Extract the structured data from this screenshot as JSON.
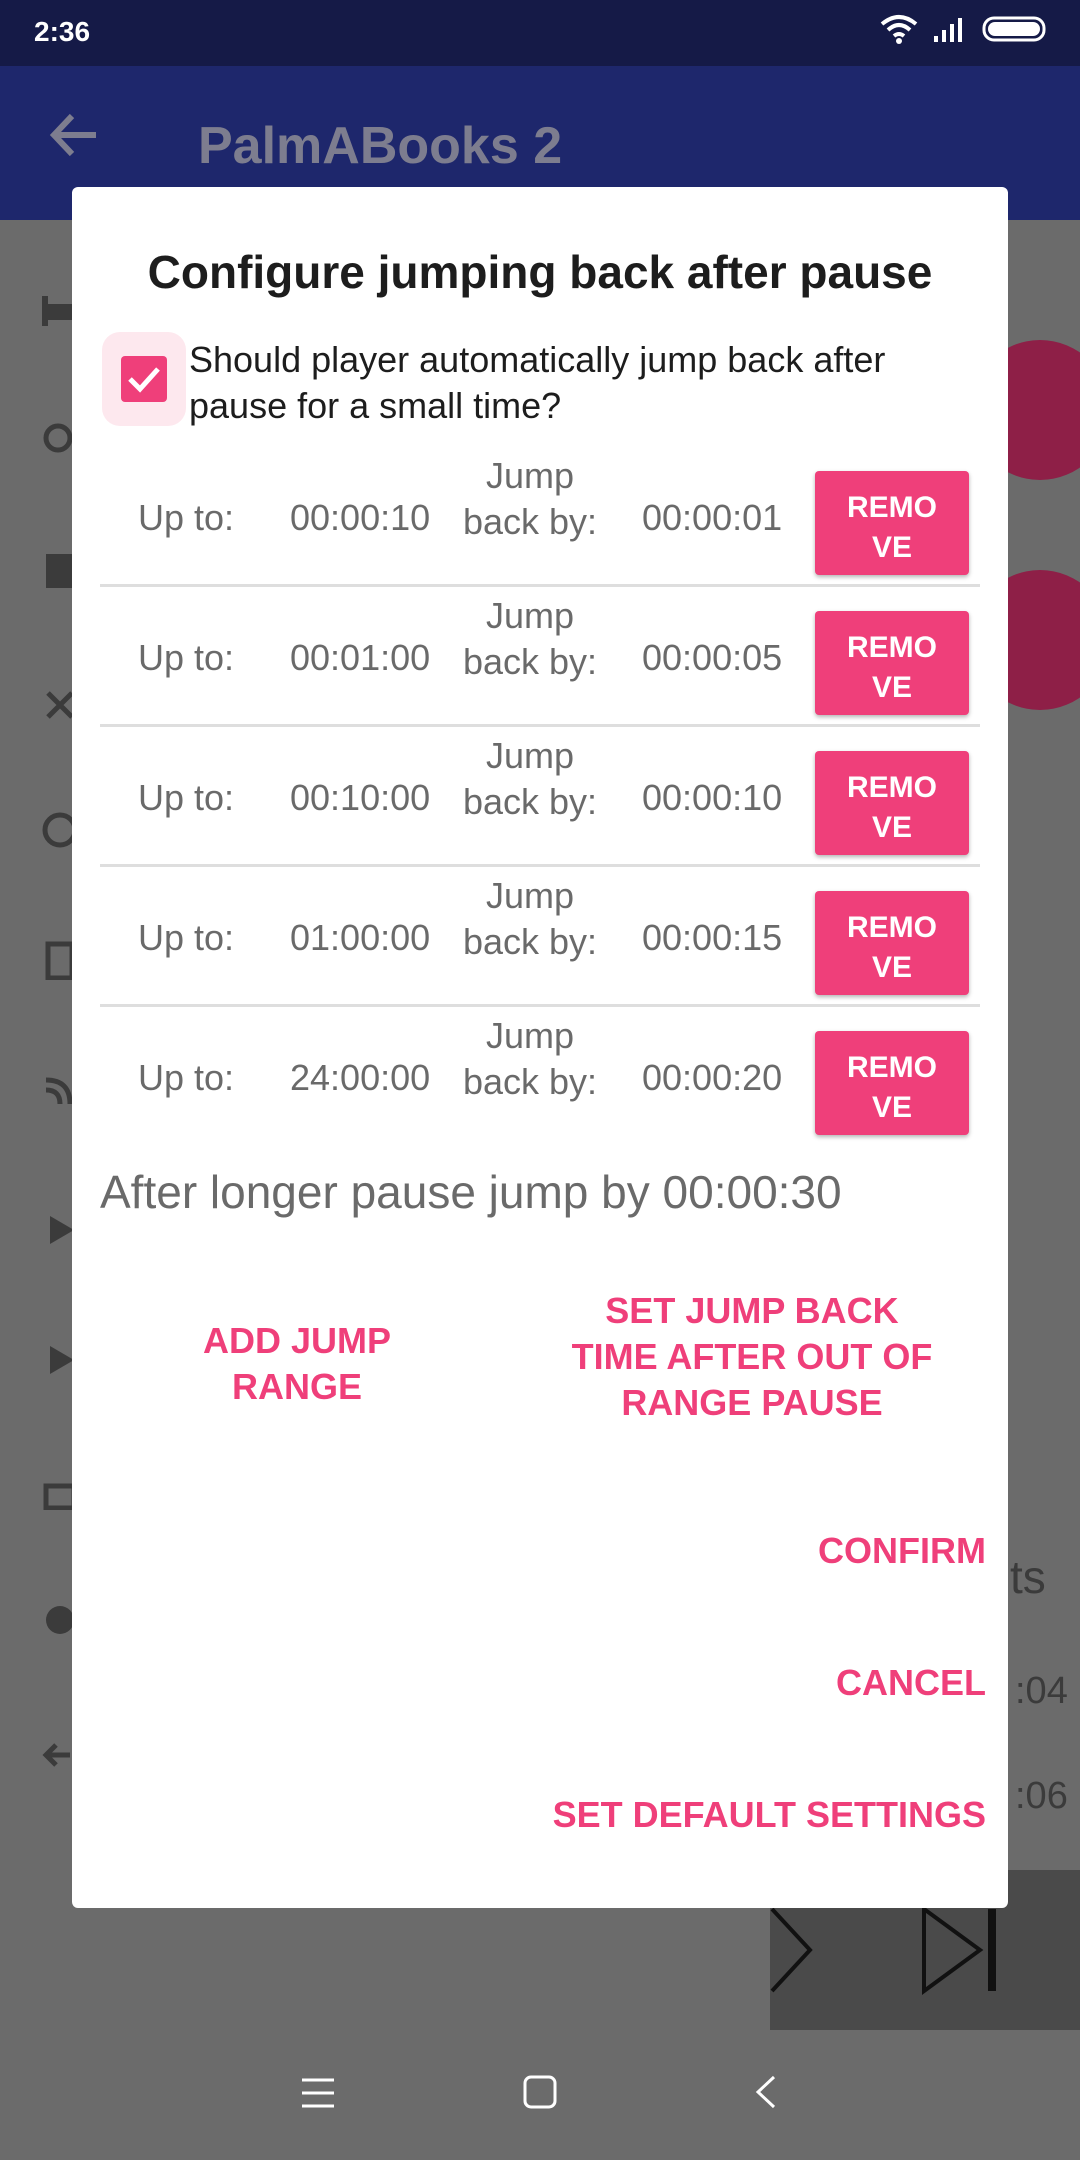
{
  "status": {
    "time": "2:36"
  },
  "app": {
    "title": "PalmABooks 2"
  },
  "dialog": {
    "title": "Configure jumping back after pause",
    "checkbox_label": "Should player automatically jump back after pause for a small time?",
    "checkbox_checked": true,
    "rows": [
      {
        "up_to_label": "Up to:",
        "up_to": "00:00:10",
        "jump_label_1": "Jump",
        "jump_label_2": "back by:",
        "jump_by": "00:00:01",
        "remove_1": "REMO",
        "remove_2": "VE"
      },
      {
        "up_to_label": "Up to:",
        "up_to": "00:01:00",
        "jump_label_1": "Jump",
        "jump_label_2": "back by:",
        "jump_by": "00:00:05",
        "remove_1": "REMO",
        "remove_2": "VE"
      },
      {
        "up_to_label": "Up to:",
        "up_to": "00:10:00",
        "jump_label_1": "Jump",
        "jump_label_2": "back by:",
        "jump_by": "00:00:10",
        "remove_1": "REMO",
        "remove_2": "VE"
      },
      {
        "up_to_label": "Up to:",
        "up_to": "01:00:00",
        "jump_label_1": "Jump",
        "jump_label_2": "back by:",
        "jump_by": "00:00:15",
        "remove_1": "REMO",
        "remove_2": "VE"
      },
      {
        "up_to_label": "Up to:",
        "up_to": "24:00:00",
        "jump_label_1": "Jump",
        "jump_label_2": "back by:",
        "jump_by": "00:00:20",
        "remove_1": "REMO",
        "remove_2": "VE"
      }
    ],
    "longer_pause": "After longer pause jump by 00:00:30",
    "add_range": "ADD JUMP RANGE",
    "set_jump_1": "SET JUMP BACK",
    "set_jump_2": "TIME AFTER OUT OF",
    "set_jump_3": "RANGE PAUSE",
    "confirm": "CONFIRM",
    "cancel": "CANCEL",
    "defaults": "SET DEFAULT SETTINGS"
  },
  "behind": {
    "text_1": "ts",
    "text_2": ":04",
    "text_3": ":06"
  },
  "colors": {
    "accent": "#ef3f7a",
    "status_bar": "#151a47",
    "app_bar": "#1e276c"
  }
}
